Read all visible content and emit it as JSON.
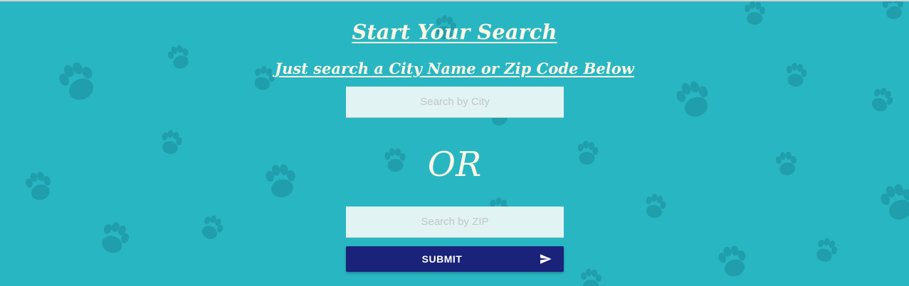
{
  "header": {
    "title": "Start Your Search",
    "subtitle": "Just search a City Name or Zip Code Below"
  },
  "search": {
    "city_placeholder": "Search by City",
    "city_value": "",
    "or_text": "OR",
    "zip_placeholder": "Search by ZIP",
    "zip_value": ""
  },
  "submit": {
    "label": "SUBMIT",
    "icon": "send-icon"
  },
  "background": {
    "color": "#29b6c3",
    "pattern": "paw-print-icon",
    "pattern_color": "#1f9aa8"
  },
  "colors": {
    "text": "#fbf6e3",
    "button": "#1a227a",
    "field": "#e1f3f2"
  }
}
